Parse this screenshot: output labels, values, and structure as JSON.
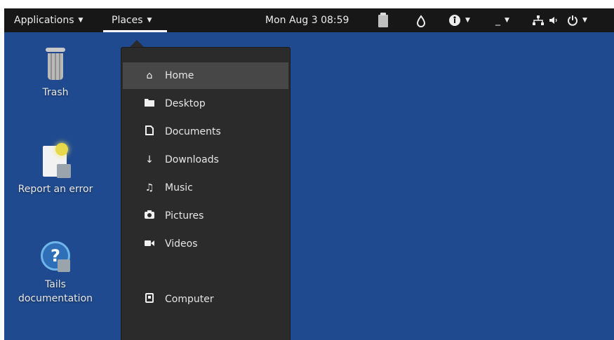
{
  "topbar": {
    "applications": "Applications",
    "places": "Places",
    "clock": "Mon Aug 3  08:59"
  },
  "desktop": {
    "icons": [
      {
        "label": "Trash",
        "icon": "trash-icon"
      },
      {
        "label": "Report an error",
        "icon": "report-error-icon"
      },
      {
        "label_lines": [
          "Tails",
          "documentation"
        ],
        "icon": "help-icon"
      }
    ]
  },
  "places_menu": {
    "items": [
      {
        "label": "Home",
        "icon": "home-icon"
      },
      {
        "label": "Desktop",
        "icon": "folder-icon"
      },
      {
        "label": "Documents",
        "icon": "document-icon"
      },
      {
        "label": "Downloads",
        "icon": "download-icon"
      },
      {
        "label": "Music",
        "icon": "music-icon"
      },
      {
        "label": "Pictures",
        "icon": "camera-icon"
      },
      {
        "label": "Videos",
        "icon": "video-icon"
      },
      {
        "label": "Computer",
        "icon": "computer-icon"
      }
    ],
    "selected": "Home"
  },
  "colors": {
    "desktop_bg": "#1f4a8f",
    "topbar_bg": "#171717",
    "menu_bg": "#2b2b2b",
    "menu_highlight": "#474747"
  }
}
